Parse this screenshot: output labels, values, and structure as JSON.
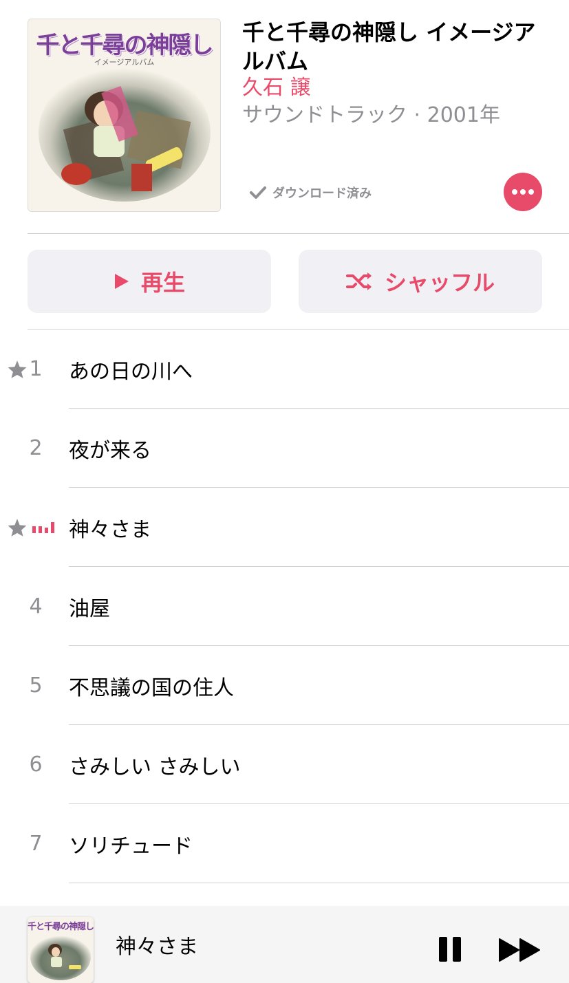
{
  "album": {
    "art_title": "千と千尋の神隠し",
    "art_subtitle": "イメージアルバム",
    "title": "千と千尋の神隠し イメージアルバム",
    "artist": "久石 譲",
    "meta": "サウンドトラック · 2001年",
    "downloaded_label": "ダウンロード済み"
  },
  "controls": {
    "play_label": "再生",
    "shuffle_label": "シャッフル"
  },
  "tracks": [
    {
      "number": "1",
      "title": "あの日の川へ",
      "starred": true,
      "playing": false
    },
    {
      "number": "2",
      "title": "夜が来る",
      "starred": false,
      "playing": false
    },
    {
      "number": "3",
      "title": "神々さま",
      "starred": true,
      "playing": true
    },
    {
      "number": "4",
      "title": "油屋",
      "starred": false,
      "playing": false
    },
    {
      "number": "5",
      "title": "不思議の国の住人",
      "starred": false,
      "playing": false
    },
    {
      "number": "6",
      "title": "さみしい さみしい",
      "starred": false,
      "playing": false
    },
    {
      "number": "7",
      "title": "ソリチュード",
      "starred": false,
      "playing": false
    }
  ],
  "now_playing": {
    "art_title": "千と千尋の神隠し",
    "title": "神々さま"
  },
  "colors": {
    "accent": "#e84a6a",
    "secondary_text": "#8e8e93",
    "button_bg": "#f0f0f5",
    "divider": "#d1d1d6"
  },
  "icons": {
    "more": "ellipsis-icon",
    "play": "play-icon",
    "shuffle": "shuffle-icon",
    "downloaded": "checkmark-icon",
    "star": "star-icon",
    "playing": "equalizer-icon",
    "pause": "pause-icon",
    "next": "forward-icon"
  }
}
